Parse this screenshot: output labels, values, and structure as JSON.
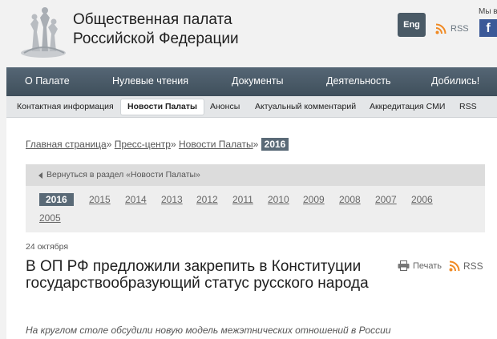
{
  "header": {
    "org_name_line1": "Общественная палата",
    "org_name_line2": "Российской Федерации",
    "lang_button": "Eng",
    "rss_label": "RSS",
    "social_label": "Мы в",
    "social_icon": "facebook-icon"
  },
  "main_nav": [
    "О Палате",
    "Нулевые чтения",
    "Документы",
    "Деятельность",
    "Добились!"
  ],
  "sub_nav": [
    {
      "label": "Контактная информация",
      "active": false
    },
    {
      "label": "Новости Палаты",
      "active": true
    },
    {
      "label": "Анонсы",
      "active": false
    },
    {
      "label": "Актуальный комментарий",
      "active": false
    },
    {
      "label": "Аккредитация СМИ",
      "active": false
    },
    {
      "label": "RSS",
      "active": false
    }
  ],
  "breadcrumbs": {
    "home": "Главная страница",
    "press": "Пресс-центр",
    "news": "Новости Палаты",
    "current": "2016",
    "separator": "»"
  },
  "back_link": "Вернуться в раздел «Новости Палаты»",
  "years": [
    "2016",
    "2015",
    "2014",
    "2013",
    "2012",
    "2011",
    "2010",
    "2009",
    "2008",
    "2007",
    "2006",
    "2005"
  ],
  "active_year": "2016",
  "article": {
    "date": "24 октября",
    "title": "В ОП РФ предложили закрепить в Конституции государствообразующий статус русского народа",
    "print_label": "Печать",
    "rss_label": "RSS",
    "lead": "На круглом столе обсудили новую модель межэтнических отношений в России"
  },
  "colors": {
    "nav_bg": "#4a5a66",
    "active_badge": "#5a6a77",
    "rss_orange": "#f08a24",
    "facebook": "#3b5998"
  }
}
